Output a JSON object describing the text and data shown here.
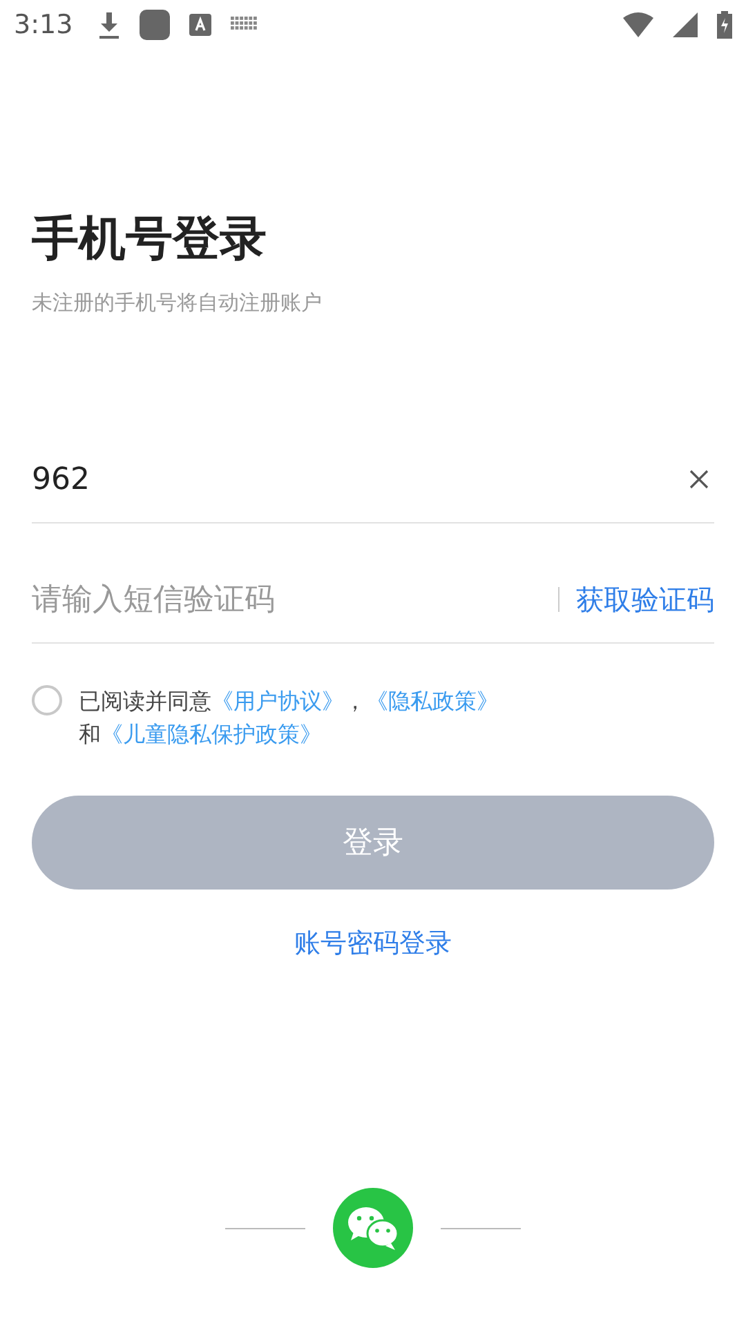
{
  "status_bar": {
    "time": "3:13"
  },
  "title": "手机号登录",
  "subtitle": "未注册的手机号将自动注册账户",
  "phone_field": {
    "value": "962"
  },
  "code_field": {
    "placeholder": "请输入短信验证码",
    "action": "获取验证码"
  },
  "agreement": {
    "checked": false,
    "segments": [
      {
        "kind": "text",
        "text": "已阅读并同意"
      },
      {
        "kind": "link",
        "text": "《用户协议》"
      },
      {
        "kind": "text",
        "text": "，"
      },
      {
        "kind": "link",
        "text": "《隐私政策》"
      },
      {
        "kind": "break"
      },
      {
        "kind": "text",
        "text": "和"
      },
      {
        "kind": "link",
        "text": "《儿童隐私保护政策》"
      }
    ]
  },
  "login_button": {
    "label": "登录",
    "disabled": true
  },
  "password_login": "账号密码登录"
}
